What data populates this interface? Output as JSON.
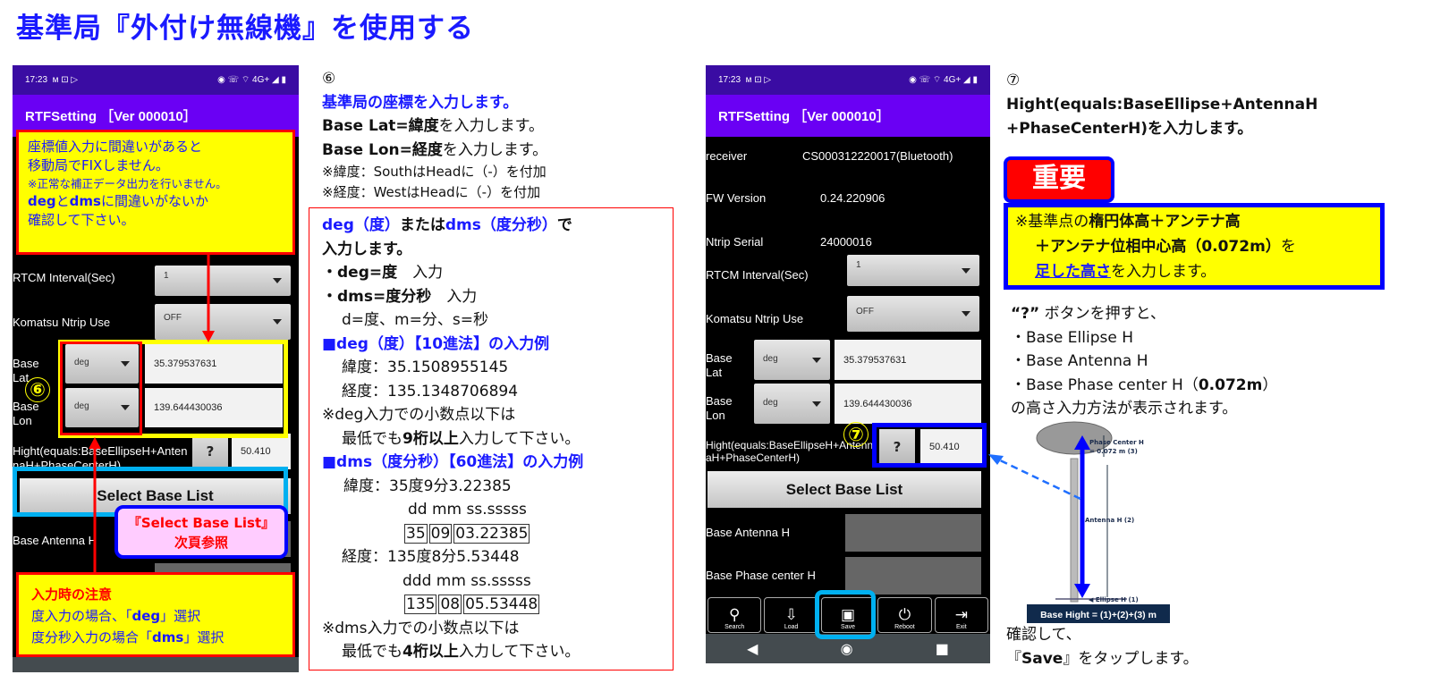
{
  "page_title": "基準局『外付け無線機』を使用する",
  "status_bar": {
    "time": "17:23",
    "left_icons": "ᴍ ⊡ ▷",
    "right_icons": "◉ ☏ ⌔ 4G+ ◢ ▮"
  },
  "app_title": "RTFSetting ［Ver 000010］",
  "phone1": {
    "rtcm_label": "RTCM Interval(Sec)",
    "rtcm_value": "1",
    "komatsu_label": "Komatsu Ntrip Use",
    "komatsu_value": "OFF",
    "lat_label": "Base Lat",
    "lat_unit": "deg",
    "lat_value": "35.379537631",
    "lon_label": "Base Lon",
    "lon_unit": "deg",
    "lon_value": "139.644430036",
    "hight_label": "Hight(equals:BaseEllipseH+AntennaH+PhaseCenterH)",
    "q": "?",
    "hight_value": "50.410",
    "select_base": "Select Base List",
    "antenna_label": "Base Antenna H",
    "callout_top": {
      "l1": "座標値入力に間違いがあると",
      "l2": "移動局でFIXしません。",
      "l3": "※正常な補正データ出力を行いません。",
      "deg": "deg",
      "to": "と",
      "dms": "dms",
      "l4rest": "に間違いがないか",
      "l5": "確認して下さい。"
    },
    "callout_pink": {
      "l1": "『Select Base List』",
      "l2": "次頁参照"
    },
    "callout_bottom": {
      "head": "入力時の注意",
      "l1a": "度入力の場合、「",
      "l1b": "deg",
      "l1c": "」選択",
      "l2a": "度分秒入力の場合「",
      "l2b": "dms",
      "l2c": "」選択"
    },
    "marker": "⑥"
  },
  "middle": {
    "num": "⑥",
    "head": "基準局の座標を入力します。",
    "lat_a": "Base Lat=緯度",
    "lat_b": "を入力します。",
    "lon_a": "Base Lon=経度",
    "lon_b": "を入力します。",
    "note1": "※緯度：SouthはHeadに（-）を付加",
    "note2": "※経度：WestはHeadに（-）を付加",
    "box": {
      "l1a": "deg（度）",
      "l1b": "または",
      "l1c": "dms（度分秒）",
      "l1d": "で",
      "l2": "入力します。",
      "b1a": "・deg=度",
      "b1b": "　入力",
      "b2a": "・dms=度分秒",
      "b2b": "　入力",
      "b3": "d=度、m=分、s=秒",
      "deg_head": "■deg（度）【10進法】の入力例",
      "deg_lat": "緯度：35.1508955145",
      "deg_lon": "経度：135.1348706894",
      "deg_note1": "※deg入力での小数点以下は",
      "deg_note2a": "最低でも",
      "deg_note2b": "9桁以上",
      "deg_note2c": "入力して下さい。",
      "dms_head": "■dms（度分秒）【60進法】の入力例",
      "dms_lat": "緯度：35度9分3.22385",
      "dms_lat_fmt": "dd mm ss.sssss",
      "dms_lat_parts": [
        "35",
        "09",
        "03.22385"
      ],
      "dms_lon": "経度：135度8分5.53448",
      "dms_lon_fmt": "ddd mm ss.sssss",
      "dms_lon_parts": [
        "135",
        "08",
        "05.53448"
      ],
      "dms_note1": "※dms入力での小数点以下は",
      "dms_note2a": "最低でも",
      "dms_note2b": "4桁以上",
      "dms_note2c": "入力して下さい。"
    }
  },
  "phone2": {
    "receiver_label": "receiver",
    "receiver_value": "CS000312220017(Bluetooth)",
    "fw_label": "FW Version",
    "fw_value": "0.24.220906",
    "serial_label": "Ntrip Serial",
    "serial_value": "24000016",
    "rtcm_label": "RTCM Interval(Sec)",
    "rtcm_value": "1",
    "komatsu_label": "Komatsu Ntrip Use",
    "komatsu_value": "OFF",
    "lat_label": "Base Lat",
    "lat_unit": "deg",
    "lat_value": "35.379537631",
    "lon_label": "Base Lon",
    "lon_unit": "deg",
    "lon_value": "139.644430036",
    "hight_label": "Hight(equals:BaseEllipseH+AntennaH+PhaseCenterH)",
    "q": "?",
    "hight_value": "50.410",
    "select_base": "Select Base List",
    "antenna_label": "Base Antenna H",
    "phase_label": "Base Phase center H",
    "toolbar": [
      {
        "icon": "search-icon",
        "label": "Search"
      },
      {
        "icon": "load-icon",
        "label": "Load"
      },
      {
        "icon": "save-icon",
        "label": "Save"
      },
      {
        "icon": "power-icon",
        "label": "Reboot"
      },
      {
        "icon": "exit-icon",
        "label": "Exit"
      }
    ],
    "marker": "⑦"
  },
  "right": {
    "num": "⑦",
    "l1": "Hight(equals:BaseEllipse+AntennaH",
    "l2": "+PhaseCenterH)を入力します。",
    "important": "重要",
    "box": {
      "a1": "※基準点の",
      "a2": "楕円体高＋アンテナ高",
      "b1": "＋アンテナ位相中心高（0.072m）",
      "b2": "を",
      "c1": "足した高さ",
      "c2": "を入力します。"
    },
    "q1a": "“?”",
    "q1b": " ボタンを押すと、",
    "i1": "・Base Ellipse H",
    "i2": "・Base Antenna H",
    "i3a": "・Base Phase center H（",
    "i3b": "0.072m",
    "i3c": "）",
    "q2": "の高さ入力方法が表示されます。",
    "diagram": {
      "phase": "Phase Center H",
      "phase_val": "= 0.072 m (3)",
      "antenna": "Antenna H (2)",
      "ellipse": "◀ Ellipse H (1)",
      "formula": "Base Hight = (1)+(2)+(3) m"
    },
    "confirm1": "確認して、",
    "confirm2a": "『",
    "confirm2b": "Save",
    "confirm2c": "』をタップします。"
  },
  "colors": {
    "title": "#1a1aff",
    "appbar": "#6a00f4",
    "status": "#3a0ca3",
    "callout_yellow": "#ffff00",
    "alert_red": "#ff0000",
    "highlight_cyan": "#00b0f0"
  }
}
